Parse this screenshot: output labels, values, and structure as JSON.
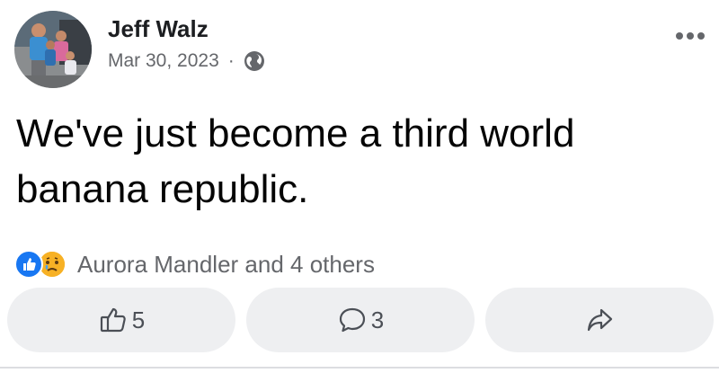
{
  "post": {
    "author": "Jeff Walz",
    "date": "Mar 30, 2023",
    "separator": "·",
    "privacy_icon": "globe-icon",
    "text": "We've just become a third world banana republic.",
    "more_icon": "more-options-icon"
  },
  "reactions": {
    "icons": [
      "like-icon",
      "sad-icon"
    ],
    "summary": "Aurora Mandler and 4 others"
  },
  "actions": {
    "like": {
      "icon": "thumbs-up-icon",
      "count": "5"
    },
    "comment": {
      "icon": "comment-icon",
      "count": "3"
    },
    "share": {
      "icon": "share-icon"
    }
  },
  "colors": {
    "accent": "#1877f2",
    "text": "#050505",
    "secondary_text": "#65676b",
    "button_bg": "#eeeff1"
  }
}
